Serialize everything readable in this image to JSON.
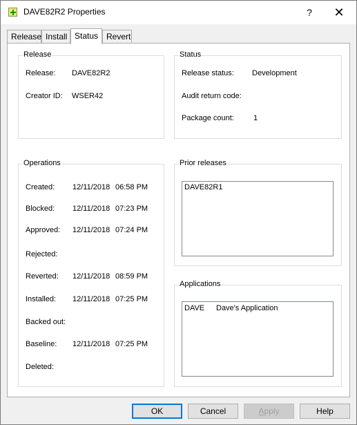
{
  "window": {
    "title": "DAVE82R2 Properties",
    "help_glyph": "?",
    "close_glyph": "✕"
  },
  "tabs": [
    {
      "label": "Release"
    },
    {
      "label": "Install"
    },
    {
      "label": "Status"
    },
    {
      "label": "Revert"
    }
  ],
  "release_group": {
    "title": "Release",
    "release_label": "Release:",
    "release_value": "DAVE82R2",
    "creator_label": "Creator ID:",
    "creator_value": "WSER42"
  },
  "status_group": {
    "title": "Status",
    "release_status_label": "Release status:",
    "release_status_value": "Development",
    "audit_label": "Audit return code:",
    "audit_value": "",
    "package_count_label": "Package count:",
    "package_count_value": "1"
  },
  "operations_group": {
    "title": "Operations",
    "rows": [
      {
        "label": "Created:",
        "date": "12/11/2018",
        "time": "06:58 PM"
      },
      {
        "label": "Blocked:",
        "date": "12/11/2018",
        "time": "07:23 PM"
      },
      {
        "label": "Approved:",
        "date": "12/11/2018",
        "time": "07:24 PM"
      },
      {
        "label": "Rejected:",
        "date": "",
        "time": ""
      },
      {
        "label": "Reverted:",
        "date": "12/11/2018",
        "time": "08:59 PM"
      },
      {
        "label": "Installed:",
        "date": "12/11/2018",
        "time": "07:25 PM"
      },
      {
        "label": "Backed out:",
        "date": "",
        "time": ""
      },
      {
        "label": "Baseline:",
        "date": "12/11/2018",
        "time": "07:25 PM"
      },
      {
        "label": "Deleted:",
        "date": "",
        "time": ""
      }
    ]
  },
  "prior_releases_group": {
    "title": "Prior releases",
    "items": [
      "DAVE82R1"
    ]
  },
  "applications_group": {
    "title": "Applications",
    "items": [
      {
        "code": "DAVE",
        "name": "Dave's Application"
      }
    ]
  },
  "buttons": {
    "ok": "OK",
    "cancel": "Cancel",
    "apply_accel": "A",
    "apply_rest": "pply",
    "help": "Help"
  }
}
